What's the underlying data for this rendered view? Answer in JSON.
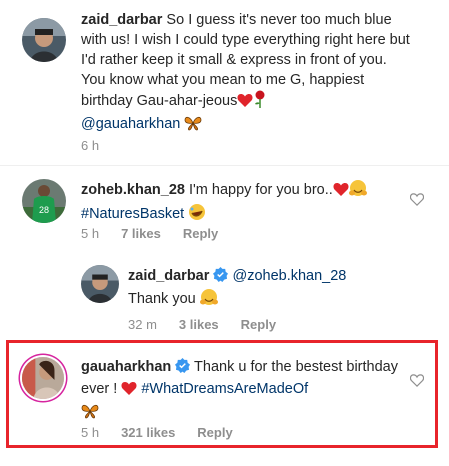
{
  "comments": [
    {
      "username": "zaid_darbar",
      "segments": [
        " So I guess it's never too much blue with us! I wish I could type everything right here but I'd rather keep it small & express in front of you. You know what you mean to me G, happiest birthday Gau-ahar-jeous"
      ],
      "mention": "@gauaharkhan",
      "time": "6 h"
    },
    {
      "username": "zoheb.khan_28",
      "text": " I'm happy for you bro..",
      "hashtag": "#NaturesBasket",
      "time": "5 h",
      "likes": "7 likes",
      "reply": "Reply"
    },
    {
      "username": "zaid_darbar",
      "mention": "@zoheb.khan_28",
      "text": "Thank you",
      "time": "32 m",
      "likes": "3 likes",
      "reply": "Reply"
    },
    {
      "username": "gauaharkhan",
      "text1": " Thank u for the bestest birthday ever !",
      "hashtag": "#WhatDreamsAreMadeOf",
      "time": "5 h",
      "likes": "321 likes",
      "reply": "Reply"
    }
  ],
  "icons": {
    "like": "heart-outline-icon",
    "verified": "verified-badge-icon"
  },
  "colors": {
    "highlight_border": "#e8242b",
    "link": "#003569",
    "meta": "#8e8e8e",
    "verified": "#3897f0"
  }
}
